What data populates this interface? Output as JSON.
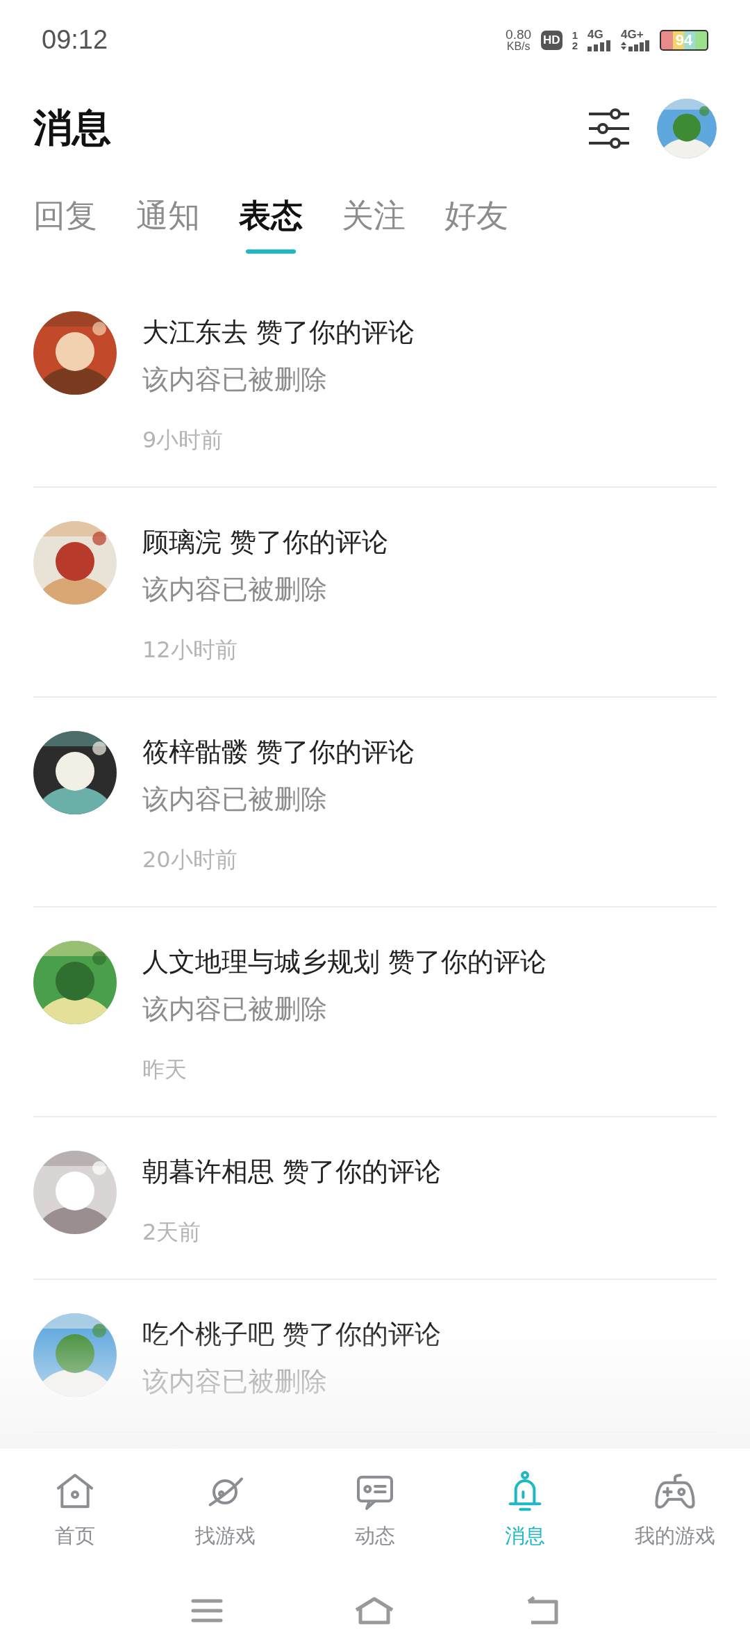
{
  "status_bar": {
    "time": "09:12",
    "speed": "0.80",
    "speed_unit": "KB/s",
    "hd": "HD",
    "sim_1": "1",
    "sim_2": "2",
    "network_1": "4G",
    "network_2": "4G+",
    "battery": "94"
  },
  "header": {
    "title": "消息"
  },
  "tabs": [
    {
      "label": "回复",
      "selected": false
    },
    {
      "label": "通知",
      "selected": false
    },
    {
      "label": "表态",
      "selected": true
    },
    {
      "label": "关注",
      "selected": false
    },
    {
      "label": "好友",
      "selected": false
    }
  ],
  "messages": [
    {
      "user": "大江东去",
      "action": "赞了你的评论",
      "content": "该内容已被删除",
      "time": "9小时前"
    },
    {
      "user": "顾璃浣",
      "action": "赞了你的评论",
      "content": "该内容已被删除",
      "time": "12小时前"
    },
    {
      "user": "筱梓骷髅",
      "action": "赞了你的评论",
      "content": "该内容已被删除",
      "time": "20小时前"
    },
    {
      "user": "人文地理与城乡规划",
      "action": "赞了你的评论",
      "content": "该内容已被删除",
      "time": "昨天"
    },
    {
      "user": "朝暮许相思",
      "action": "赞了你的评论",
      "time": "2天前"
    },
    {
      "user": "吃个桃子吧",
      "action": "赞了你的评论",
      "content": "该内容已被删除"
    }
  ],
  "bottom_nav": [
    {
      "label": "首页",
      "selected": false
    },
    {
      "label": "找游戏",
      "selected": false
    },
    {
      "label": "动态",
      "selected": false
    },
    {
      "label": "消息",
      "selected": true
    },
    {
      "label": "我的游戏",
      "selected": false
    }
  ]
}
